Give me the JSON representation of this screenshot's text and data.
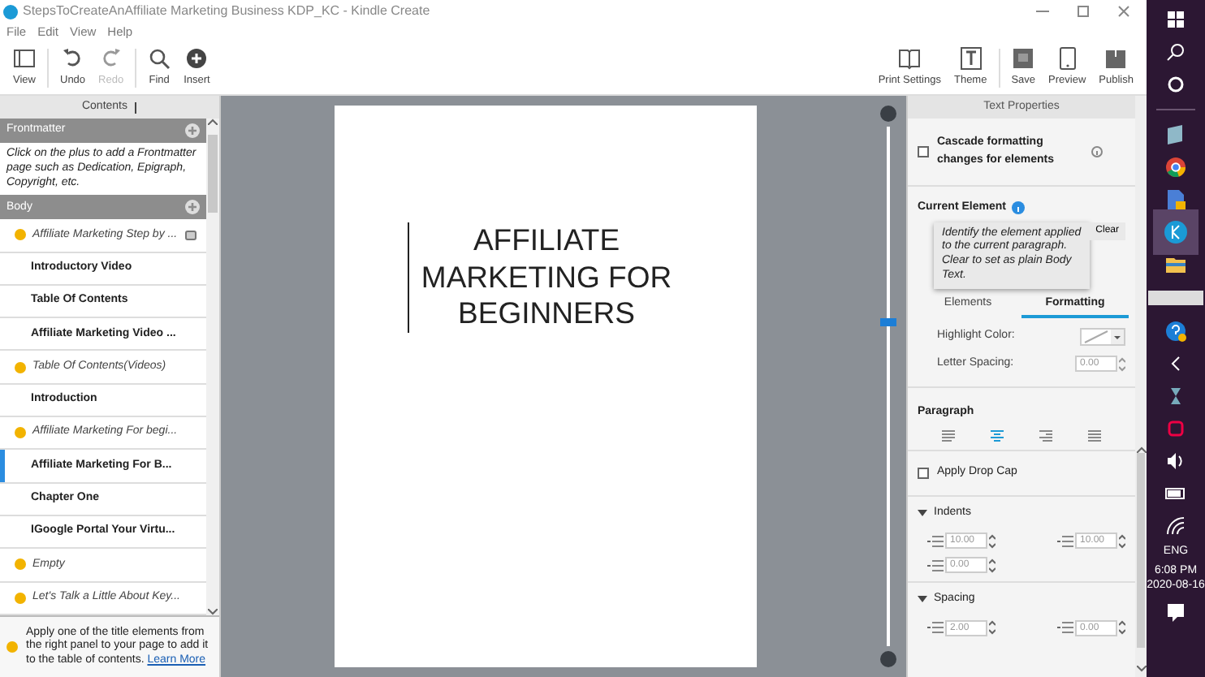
{
  "window": {
    "title": "StepsToCreateAnAffiliate Marketing Business KDP_KC - Kindle Create"
  },
  "menu": [
    {
      "label": "File"
    },
    {
      "label": "Edit"
    },
    {
      "label": "View"
    },
    {
      "label": "Help"
    }
  ],
  "toolbar_left": [
    {
      "label": "View",
      "disabled": false
    },
    {
      "label": "Undo",
      "disabled": false
    },
    {
      "label": "Redo",
      "disabled": true
    },
    {
      "label": "Find",
      "disabled": false
    },
    {
      "label": "Insert",
      "disabled": false
    }
  ],
  "toolbar_right": [
    {
      "label": "Print Settings",
      "disabled": false
    },
    {
      "label": "Theme",
      "disabled": false
    },
    {
      "label": "Save",
      "disabled": false
    },
    {
      "label": "Preview",
      "disabled": false
    },
    {
      "label": "Publish",
      "disabled": false
    }
  ],
  "contents": {
    "title": "Contents",
    "frontmatter": {
      "label": "Frontmatter",
      "hint": "Click on the plus to add a Frontmatter page such as Dedication, Epigraph, Copyright, etc."
    },
    "body": {
      "label": "Body"
    },
    "items": [
      {
        "text": "Affiliate Marketing Step by ...",
        "kind": "untitled",
        "selected": false
      },
      {
        "text": "Introductory Video",
        "kind": "title",
        "selected": false
      },
      {
        "text": "Table Of Contents",
        "kind": "title",
        "selected": false
      },
      {
        "text": "Affiliate Marketing Video ...",
        "kind": "title",
        "selected": false
      },
      {
        "text": "Table Of Contents(Videos)",
        "kind": "untitled",
        "selected": false
      },
      {
        "text": "Introduction",
        "kind": "title",
        "selected": false
      },
      {
        "text": "Affiliate Marketing For begi...",
        "kind": "untitled",
        "selected": false
      },
      {
        "text": "Affiliate Marketing For B...",
        "kind": "title",
        "selected": true
      },
      {
        "text": "Chapter One",
        "kind": "title",
        "selected": false
      },
      {
        "text": "IGoogle Portal Your Virtu...",
        "kind": "title",
        "selected": false
      },
      {
        "text": "Empty",
        "kind": "untitled",
        "selected": false
      },
      {
        "text": "Let's Talk a Little About Key...",
        "kind": "untitled",
        "selected": false
      }
    ],
    "footer": "Apply one of the title elements from the right panel to your page to add it to the table of contents.",
    "footer_link": "Learn More"
  },
  "page": {
    "text": "AFFILIATE MARKETING FOR BEGINNERS"
  },
  "zoom": {
    "level": 0.63
  },
  "properties": {
    "title": "Text Properties",
    "cascade": {
      "label": "Cascade formatting changes for elements",
      "checked": false
    },
    "current_element": {
      "label": "Current Element",
      "tooltip": "Identify the element applied to the current paragraph. Clear to set as plain Body Text.",
      "clear": "Clear"
    },
    "tabs": [
      {
        "label": "Elements",
        "selected": false
      },
      {
        "label": "Formatting",
        "selected": true
      }
    ],
    "highlight": {
      "label": "Highlight Color:"
    },
    "letter_spacing": {
      "label": "Letter Spacing:",
      "value": "0.00"
    },
    "paragraph": {
      "label": "Paragraph",
      "alignments": [
        {
          "selected": false
        },
        {
          "selected": true
        },
        {
          "selected": false
        },
        {
          "selected": false
        }
      ]
    },
    "drop_cap": {
      "label": "Apply Drop Cap",
      "checked": false
    },
    "indents": {
      "label": "Indents",
      "expanded": true,
      "values": [
        "10.00",
        "10.00",
        "0.00"
      ]
    },
    "spacing": {
      "label": "Spacing",
      "expanded": true,
      "values": [
        "2.00",
        "0.00"
      ]
    }
  },
  "taskbar": {
    "language": "ENG",
    "time": "6:08 PM",
    "date": "2020-08-16"
  }
}
